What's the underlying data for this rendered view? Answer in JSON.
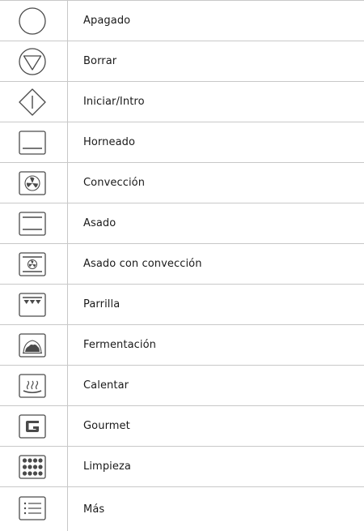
{
  "rows": [
    {
      "icon": "off-circle-icon",
      "label": "Apagado"
    },
    {
      "icon": "clear-triangle-icon",
      "label": "Borrar"
    },
    {
      "icon": "start-diamond-icon",
      "label": "Iniciar/Intro"
    },
    {
      "icon": "bake-icon",
      "label": "Horneado"
    },
    {
      "icon": "convection-fan-icon",
      "label": "Convección"
    },
    {
      "icon": "broil-icon",
      "label": "Asado"
    },
    {
      "icon": "convection-broil-icon",
      "label": "Asado con convección"
    },
    {
      "icon": "grill-icon",
      "label": "Parrilla"
    },
    {
      "icon": "proof-bread-icon",
      "label": "Fermentación"
    },
    {
      "icon": "warm-icon",
      "label": "Calentar"
    },
    {
      "icon": "gourmet-icon",
      "label": "Gourmet"
    },
    {
      "icon": "self-clean-icon",
      "label": "Limpieza"
    },
    {
      "icon": "more-menu-icon",
      "label": "Más"
    }
  ]
}
